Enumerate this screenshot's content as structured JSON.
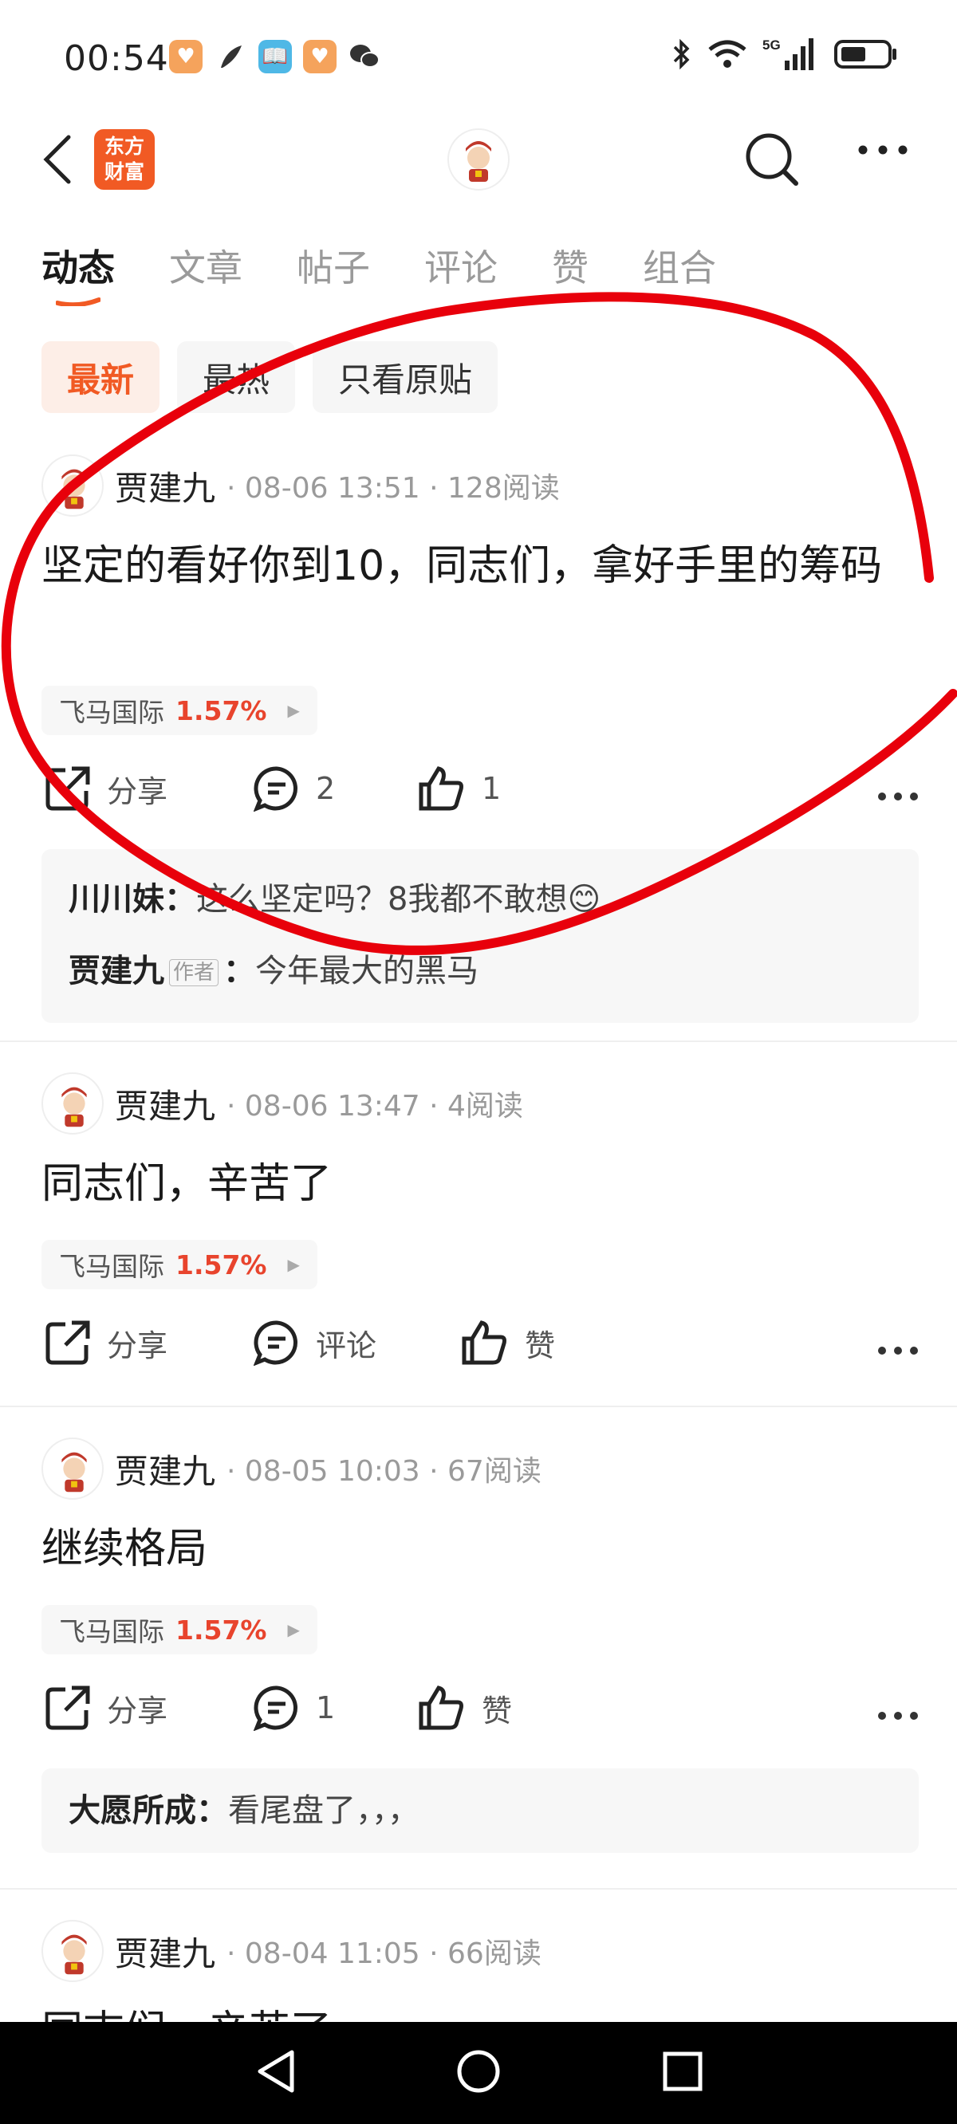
{
  "status_bar": {
    "time": "00:54",
    "icons": [
      "heart-app-icon",
      "feather-app-icon",
      "book-app-icon",
      "heart-app-icon",
      "wechat-icon"
    ],
    "sys": [
      "bluetooth-icon",
      "wifi-icon",
      "5g-signal-icon",
      "battery-icon"
    ],
    "network": "5G"
  },
  "navbar": {
    "logo_line1": "东方",
    "logo_line2": "财富"
  },
  "tabs": [
    {
      "label": "动态"
    },
    {
      "label": "文章"
    },
    {
      "label": "帖子"
    },
    {
      "label": "评论"
    },
    {
      "label": "赞"
    },
    {
      "label": "组合"
    }
  ],
  "filters": [
    {
      "label": "最新"
    },
    {
      "label": "最热"
    },
    {
      "label": "只看原贴"
    }
  ],
  "posts": [
    {
      "author": "贾建九",
      "meta": "· 08-06 13:51 · 128阅读",
      "text": "坚定的看好你到10，同志们，拿好手里的筹码",
      "stock": "飞马国际",
      "pct": "1.57%",
      "share": "分享",
      "comment": "2",
      "like": "1",
      "comments": [
        {
          "name": "川川妹",
          "sep": "：",
          "text": "这么坚定吗？8我都不敢想😊"
        },
        {
          "name": "贾建九",
          "tag": "作者",
          "sep": "：",
          "text": "今年最大的黑马"
        }
      ]
    },
    {
      "author": "贾建九",
      "meta": "· 08-06 13:47 · 4阅读",
      "text": "同志们，辛苦了",
      "stock": "飞马国际",
      "pct": "1.57%",
      "share": "分享",
      "comment": "评论",
      "like": "赞"
    },
    {
      "author": "贾建九",
      "meta": "· 08-05 10:03 · 67阅读",
      "text": "继续格局",
      "stock": "飞马国际",
      "pct": "1.57%",
      "share": "分享",
      "comment": "1",
      "like": "赞",
      "comments": [
        {
          "name": "大愿所成",
          "sep": "：",
          "text": "看尾盘了，，，"
        }
      ]
    },
    {
      "author": "贾建九",
      "meta": "· 08-04 11:05 · 66阅读",
      "text": "同志们，辛苦了"
    }
  ],
  "colors": {
    "accent": "#f15a24",
    "rise": "#e8442d",
    "annotation": "#e8000b"
  }
}
